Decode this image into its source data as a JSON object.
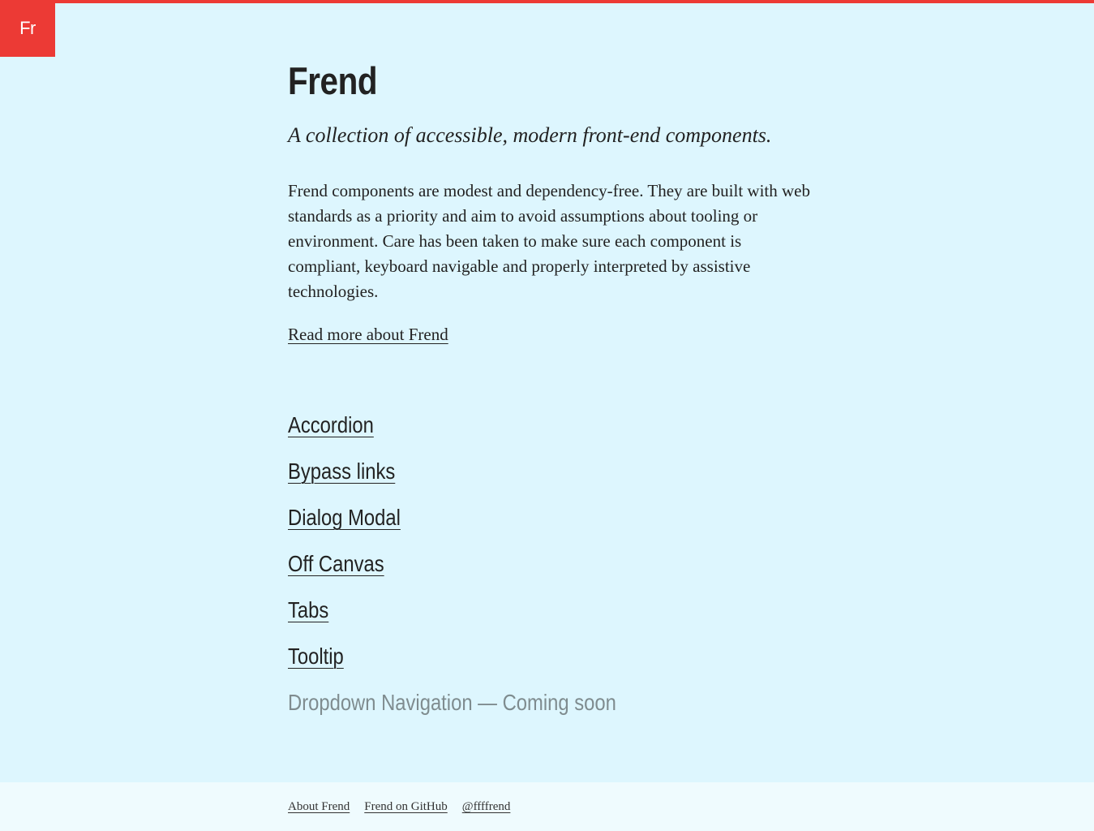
{
  "logo": {
    "text": "Fr"
  },
  "header": {
    "title": "Frend",
    "tagline": "A collection of accessible, modern front-end components."
  },
  "intro": {
    "text": "Frend components are modest and dependency-free. They are built with web standards as a priority and aim to avoid assumptions about tooling or environment. Care has been taken to make sure each component is compliant, keyboard navigable and properly interpreted by assistive technologies.",
    "read_more_label": "Read more about Frend"
  },
  "components": {
    "items": [
      {
        "label": "Accordion"
      },
      {
        "label": "Bypass links"
      },
      {
        "label": "Dialog Modal"
      },
      {
        "label": "Off Canvas"
      },
      {
        "label": "Tabs"
      },
      {
        "label": "Tooltip"
      }
    ],
    "coming_soon": "Dropdown Navigation — Coming soon"
  },
  "footer": {
    "links": [
      {
        "label": "About Frend"
      },
      {
        "label": "Frend on GitHub"
      },
      {
        "label": "@ffffrend"
      }
    ]
  },
  "colors": {
    "accent": "#ec3a35",
    "background": "#ddf6fe",
    "footer_background": "#effbfe",
    "text": "#222222",
    "muted": "#7f8c8f"
  }
}
